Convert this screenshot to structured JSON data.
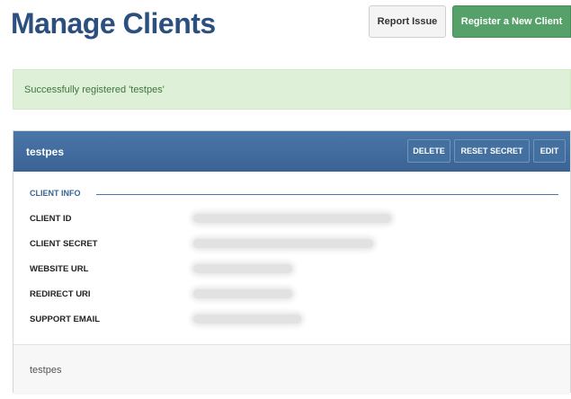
{
  "page": {
    "title": "Manage Clients"
  },
  "toolbar": {
    "report_label": "Report Issue",
    "register_label": "Register a New Client"
  },
  "alert": {
    "message": "Successfully registered 'testpes'"
  },
  "client": {
    "name": "testpes",
    "actions": {
      "delete_label": "DELETE",
      "reset_label": "RESET SECRET",
      "edit_label": "EDIT"
    },
    "section_label": "CLIENT INFO",
    "fields": [
      {
        "label": "CLIENT ID"
      },
      {
        "label": "CLIENT SECRET"
      },
      {
        "label": "WEBSITE URL"
      },
      {
        "label": "REDIRECT URI"
      },
      {
        "label": "SUPPORT EMAIL"
      }
    ],
    "footer_text": "testpes"
  },
  "colors": {
    "title": "#2b4f7e",
    "header": "#4a76a8",
    "register": "#56a06a",
    "alert_bg": "#dff0d8"
  }
}
